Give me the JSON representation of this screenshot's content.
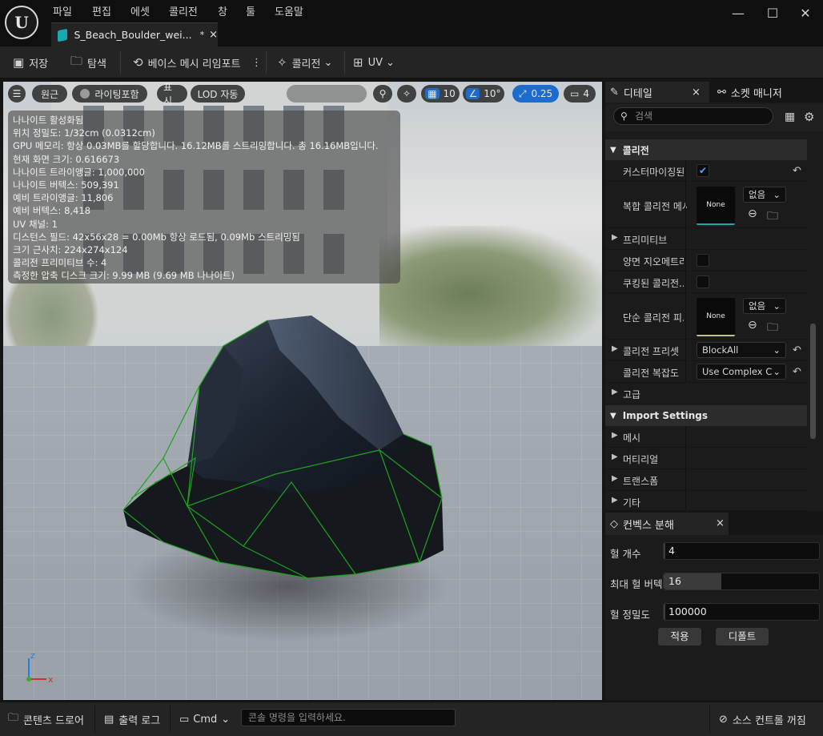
{
  "app": {
    "logo": "U"
  },
  "menu": [
    "파일",
    "편집",
    "에셋",
    "콜리전",
    "창",
    "툴",
    "도움말"
  ],
  "document_tab": {
    "label": "S_Beach_Boulder_wei...",
    "dirty": "*",
    "close": "×"
  },
  "window_controls": {
    "minimize": "—",
    "maximize": "☐",
    "close": "✕"
  },
  "toolbar": {
    "save": "저장",
    "browse": "탐색",
    "reimport_base_mesh": "베이스 메시 리임포트",
    "more": "⋮",
    "collision": "콜리전",
    "uv": "UV"
  },
  "viewport": {
    "controls": {
      "menu": "☰",
      "perspective": "원근",
      "lighting": "라이팅포함",
      "show": "표시",
      "lod": "LOD 자동",
      "grid_size": "10",
      "rotation_snap": "10°",
      "scale_snap": "0.25",
      "camera_speed": "4"
    },
    "stats": [
      "나나이트 활성화됨",
      "위치 정밀도: 1/32cm (0.0312cm)",
      "GPU 메모리: 항상 0.03MB를 할당합니다. 16.12MB를 스트리밍합니다. 총 16.16MB입니다.",
      "현재 화면 크기: 0.616673",
      "나나이트 트라이앵글: 1,000,000",
      "나나이트 버텍스: 509,391",
      "예비 트라이앵글: 11,806",
      "예비 버텍스: 8,418",
      "UV 채널: 1",
      "디스턴스 필드: 42x56x28 = 0.00Mb 항상 로드됨, 0.09Mb 스트리밍됨",
      "크기 근사치: 224x274x124",
      "콜리전 프리미티브 수: 4",
      "측정한 압축 디스크 크기: 9.99 MB (9.69 MB 나나이트)"
    ],
    "axis": {
      "x": "x",
      "y": "y",
      "z": "z"
    }
  },
  "details": {
    "tab_details": "디테일",
    "tab_socket_manager": "소켓 매니저",
    "search_placeholder": "검색",
    "categories": {
      "collision": "콜리전",
      "advanced": "고급",
      "import_settings": "Import Settings"
    },
    "props": {
      "customized": "커스터마이징된...",
      "complex_collision_mesh": "복합 콜리전 메시",
      "thumb_none": "None",
      "none_dropdown": "없음",
      "primitives": "프리미티브",
      "double_sided": "양면 지오메트리",
      "cooked": "쿠킹된 콜리전...",
      "simple_collision": "단순 콜리전 피...",
      "collision_preset": "콜리전 프리셋",
      "collision_preset_value": "BlockAll",
      "collision_complexity": "콜리전 복잡도",
      "collision_complexity_value": "Use Complex C",
      "mesh": "메시",
      "material": "머티리얼",
      "transform": "트랜스폼",
      "misc": "기타"
    }
  },
  "convex": {
    "title": "컨벡스 분해",
    "close": "×",
    "hull_count_label": "헐 개수",
    "hull_count": "4",
    "hull_count_fill": 0.01,
    "max_verts_label": "최대 헐 버텍",
    "max_verts": "16",
    "max_verts_fill": 0.37,
    "precision_label": "헐 정밀도",
    "precision": "100000",
    "precision_fill": 0.01,
    "apply": "적용",
    "defaults": "디폴트"
  },
  "bottom": {
    "content_drawer": "콘텐츠 드로어",
    "output_log": "출력 로그",
    "cmd": "Cmd",
    "cmd_placeholder": "콘솔 명령을 입력하세요.",
    "source_control": "소스 컨트롤 꺼짐"
  },
  "colors": {
    "accent_blue": "#1c6ccf",
    "teal_icon": "#18a8b0",
    "collision_wire": "#1fa21f",
    "checkbox_blue": "#4ca3ff"
  }
}
